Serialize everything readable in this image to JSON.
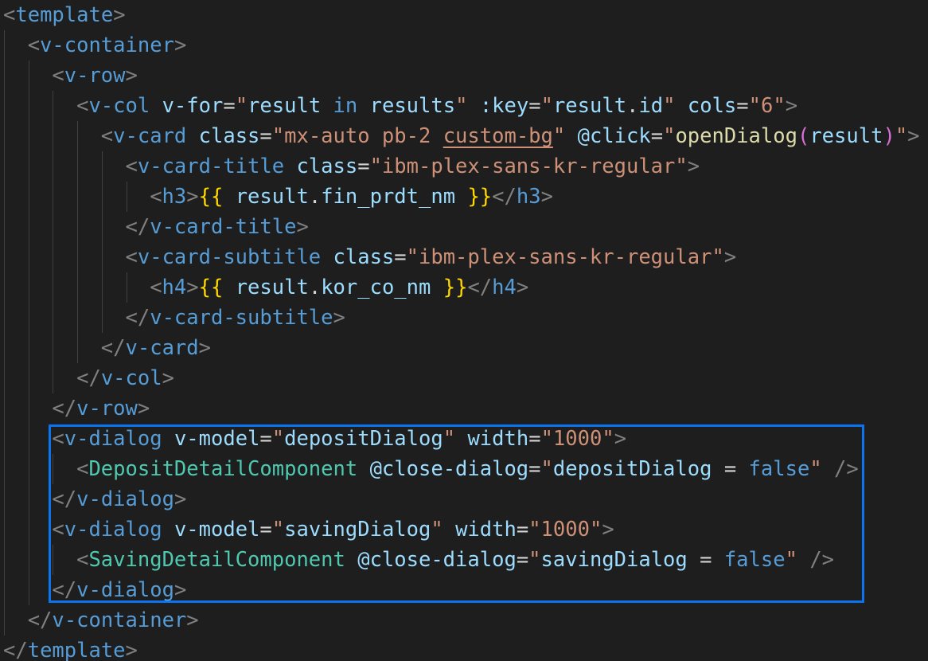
{
  "editor": {
    "language": "vue",
    "highlight_color": "#0a74f0",
    "lines": [
      {
        "indent": 0,
        "tokens": [
          [
            "punct",
            "<"
          ],
          [
            "tag",
            "template"
          ],
          [
            "punct",
            ">"
          ]
        ]
      },
      {
        "indent": 1,
        "tokens": [
          [
            "punct",
            "<"
          ],
          [
            "tag",
            "v-container"
          ],
          [
            "punct",
            ">"
          ]
        ]
      },
      {
        "indent": 2,
        "tokens": [
          [
            "punct",
            "<"
          ],
          [
            "tag",
            "v-row"
          ],
          [
            "punct",
            ">"
          ]
        ]
      },
      {
        "indent": 3,
        "tokens": [
          [
            "punct",
            "<"
          ],
          [
            "tag",
            "v-col"
          ],
          [
            "plain",
            " "
          ],
          [
            "attr",
            "v-for"
          ],
          [
            "plain",
            "="
          ],
          [
            "str",
            "\""
          ],
          [
            "attr",
            "result"
          ],
          [
            "plain",
            " "
          ],
          [
            "kw",
            "in"
          ],
          [
            "plain",
            " "
          ],
          [
            "attr",
            "results"
          ],
          [
            "str",
            "\""
          ],
          [
            "plain",
            " "
          ],
          [
            "attr",
            ":key"
          ],
          [
            "plain",
            "="
          ],
          [
            "str",
            "\""
          ],
          [
            "attr",
            "result"
          ],
          [
            "plain",
            "."
          ],
          [
            "attr",
            "id"
          ],
          [
            "str",
            "\""
          ],
          [
            "plain",
            " "
          ],
          [
            "attr",
            "cols"
          ],
          [
            "plain",
            "="
          ],
          [
            "str",
            "\"6\""
          ],
          [
            "punct",
            ">"
          ]
        ]
      },
      {
        "indent": 4,
        "tokens": [
          [
            "punct",
            "<"
          ],
          [
            "tag",
            "v-card"
          ],
          [
            "plain",
            " "
          ],
          [
            "attr",
            "class"
          ],
          [
            "plain",
            "="
          ],
          [
            "str",
            "\"mx-auto pb-2 "
          ],
          [
            "squiggle",
            "custom-bg"
          ],
          [
            "str",
            "\""
          ],
          [
            "plain",
            " "
          ],
          [
            "attr",
            "@click"
          ],
          [
            "plain",
            "="
          ],
          [
            "str",
            "\""
          ],
          [
            "fn",
            "openDialog"
          ],
          [
            "paren",
            "("
          ],
          [
            "attr",
            "result"
          ],
          [
            "paren",
            ")"
          ],
          [
            "str",
            "\""
          ],
          [
            "punct",
            ">"
          ]
        ]
      },
      {
        "indent": 5,
        "tokens": [
          [
            "punct",
            "<"
          ],
          [
            "tag",
            "v-card-title"
          ],
          [
            "plain",
            " "
          ],
          [
            "attr",
            "class"
          ],
          [
            "plain",
            "="
          ],
          [
            "str",
            "\"ibm-plex-sans-kr-regular\""
          ],
          [
            "punct",
            ">"
          ]
        ]
      },
      {
        "indent": 6,
        "tokens": [
          [
            "punct",
            "<"
          ],
          [
            "tag",
            "h3"
          ],
          [
            "punct",
            ">"
          ],
          [
            "brace",
            "{{"
          ],
          [
            "plain",
            " "
          ],
          [
            "attr",
            "result"
          ],
          [
            "plain",
            "."
          ],
          [
            "attr",
            "fin_prdt_nm"
          ],
          [
            "plain",
            " "
          ],
          [
            "brace",
            "}}"
          ],
          [
            "punct",
            "</"
          ],
          [
            "tag",
            "h3"
          ],
          [
            "punct",
            ">"
          ]
        ]
      },
      {
        "indent": 5,
        "tokens": [
          [
            "punct",
            "</"
          ],
          [
            "tag",
            "v-card-title"
          ],
          [
            "punct",
            ">"
          ]
        ]
      },
      {
        "indent": 5,
        "tokens": [
          [
            "punct",
            "<"
          ],
          [
            "tag",
            "v-card-subtitle"
          ],
          [
            "plain",
            " "
          ],
          [
            "attr",
            "class"
          ],
          [
            "plain",
            "="
          ],
          [
            "str",
            "\"ibm-plex-sans-kr-regular\""
          ],
          [
            "punct",
            ">"
          ]
        ]
      },
      {
        "indent": 6,
        "tokens": [
          [
            "punct",
            "<"
          ],
          [
            "tag",
            "h4"
          ],
          [
            "punct",
            ">"
          ],
          [
            "brace",
            "{{"
          ],
          [
            "plain",
            " "
          ],
          [
            "attr",
            "result"
          ],
          [
            "plain",
            "."
          ],
          [
            "attr",
            "kor_co_nm"
          ],
          [
            "plain",
            " "
          ],
          [
            "brace",
            "}}"
          ],
          [
            "punct",
            "</"
          ],
          [
            "tag",
            "h4"
          ],
          [
            "punct",
            ">"
          ]
        ]
      },
      {
        "indent": 5,
        "tokens": [
          [
            "punct",
            "</"
          ],
          [
            "tag",
            "v-card-subtitle"
          ],
          [
            "punct",
            ">"
          ]
        ]
      },
      {
        "indent": 4,
        "tokens": [
          [
            "punct",
            "</"
          ],
          [
            "tag",
            "v-card"
          ],
          [
            "punct",
            ">"
          ]
        ]
      },
      {
        "indent": 3,
        "tokens": [
          [
            "punct",
            "</"
          ],
          [
            "tag",
            "v-col"
          ],
          [
            "punct",
            ">"
          ]
        ]
      },
      {
        "indent": 2,
        "tokens": [
          [
            "punct",
            "</"
          ],
          [
            "tag",
            "v-row"
          ],
          [
            "punct",
            ">"
          ]
        ]
      },
      {
        "indent": 2,
        "tokens": [
          [
            "punct",
            "<"
          ],
          [
            "tag",
            "v-dialog"
          ],
          [
            "plain",
            " "
          ],
          [
            "attr",
            "v-model"
          ],
          [
            "plain",
            "="
          ],
          [
            "str",
            "\""
          ],
          [
            "attr",
            "depositDialog"
          ],
          [
            "str",
            "\""
          ],
          [
            "plain",
            " "
          ],
          [
            "attr",
            "width"
          ],
          [
            "plain",
            "="
          ],
          [
            "str",
            "\"1000\""
          ],
          [
            "punct",
            ">"
          ]
        ]
      },
      {
        "indent": 3,
        "tokens": [
          [
            "punct",
            "<"
          ],
          [
            "comp",
            "DepositDetailComponent"
          ],
          [
            "plain",
            " "
          ],
          [
            "attr",
            "@close-dialog"
          ],
          [
            "plain",
            "="
          ],
          [
            "str",
            "\""
          ],
          [
            "attr",
            "depositDialog"
          ],
          [
            "plain",
            " = "
          ],
          [
            "kw",
            "false"
          ],
          [
            "str",
            "\""
          ],
          [
            "plain",
            " "
          ],
          [
            "punct",
            "/>"
          ]
        ]
      },
      {
        "indent": 2,
        "tokens": [
          [
            "punct",
            "</"
          ],
          [
            "tag",
            "v-dialog"
          ],
          [
            "punct",
            ">"
          ]
        ]
      },
      {
        "indent": 2,
        "tokens": [
          [
            "punct",
            "<"
          ],
          [
            "tag",
            "v-dialog"
          ],
          [
            "plain",
            " "
          ],
          [
            "attr",
            "v-model"
          ],
          [
            "plain",
            "="
          ],
          [
            "str",
            "\""
          ],
          [
            "attr",
            "savingDialog"
          ],
          [
            "str",
            "\""
          ],
          [
            "plain",
            " "
          ],
          [
            "attr",
            "width"
          ],
          [
            "plain",
            "="
          ],
          [
            "str",
            "\"1000\""
          ],
          [
            "punct",
            ">"
          ]
        ]
      },
      {
        "indent": 3,
        "tokens": [
          [
            "punct",
            "<"
          ],
          [
            "comp",
            "SavingDetailComponent"
          ],
          [
            "plain",
            " "
          ],
          [
            "attr",
            "@close-dialog"
          ],
          [
            "plain",
            "="
          ],
          [
            "str",
            "\""
          ],
          [
            "attr",
            "savingDialog"
          ],
          [
            "plain",
            " = "
          ],
          [
            "kw",
            "false"
          ],
          [
            "str",
            "\""
          ],
          [
            "plain",
            " "
          ],
          [
            "punct",
            "/>"
          ]
        ]
      },
      {
        "indent": 2,
        "tokens": [
          [
            "punct",
            "</"
          ],
          [
            "tag",
            "v-dialog"
          ],
          [
            "punct",
            ">"
          ]
        ]
      },
      {
        "indent": 1,
        "tokens": [
          [
            "punct",
            "</"
          ],
          [
            "tag",
            "v-container"
          ],
          [
            "punct",
            ">"
          ]
        ]
      },
      {
        "indent": 0,
        "tokens": [
          [
            "punct",
            "</"
          ],
          [
            "tag",
            "template"
          ],
          [
            "punct",
            ">"
          ]
        ]
      }
    ]
  }
}
